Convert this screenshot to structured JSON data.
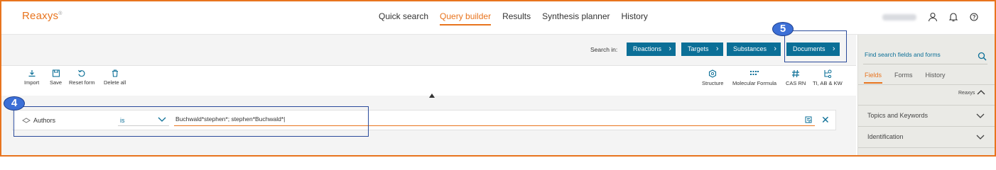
{
  "app": {
    "logo": "Reaxys",
    "logo_mark": "®"
  },
  "nav": {
    "items": [
      "Quick search",
      "Query builder",
      "Results",
      "Synthesis planner",
      "History"
    ],
    "active": "Query builder"
  },
  "header_icons": [
    "user-icon",
    "bell-icon",
    "help-icon"
  ],
  "search_in": {
    "label": "Search in:",
    "buttons": [
      "Reactions",
      "Targets",
      "Substances",
      "Documents"
    ]
  },
  "toolbar": {
    "left": [
      "Import",
      "Save",
      "Reset form",
      "Delete all"
    ],
    "right": [
      "Structure",
      "Molecular Formula",
      "CAS RN",
      "TI, AB & KW"
    ]
  },
  "query": {
    "field": "Authors",
    "operator": "is",
    "value": "Buchwald*stephen*; stephen*Buchwald*|"
  },
  "annotations": {
    "badge_4": "4",
    "badge_5": "5"
  },
  "right_panel": {
    "search_placeholder": "Find search fields and forms",
    "tabs": [
      "Fields",
      "Forms",
      "History"
    ],
    "active_tab": "Fields",
    "source": "Reaxys",
    "sections": [
      "Topics and Keywords",
      "Identification"
    ]
  },
  "colors": {
    "accent": "#e8741e",
    "primary": "#0b6f97",
    "annotation": "#2b4b9b"
  }
}
